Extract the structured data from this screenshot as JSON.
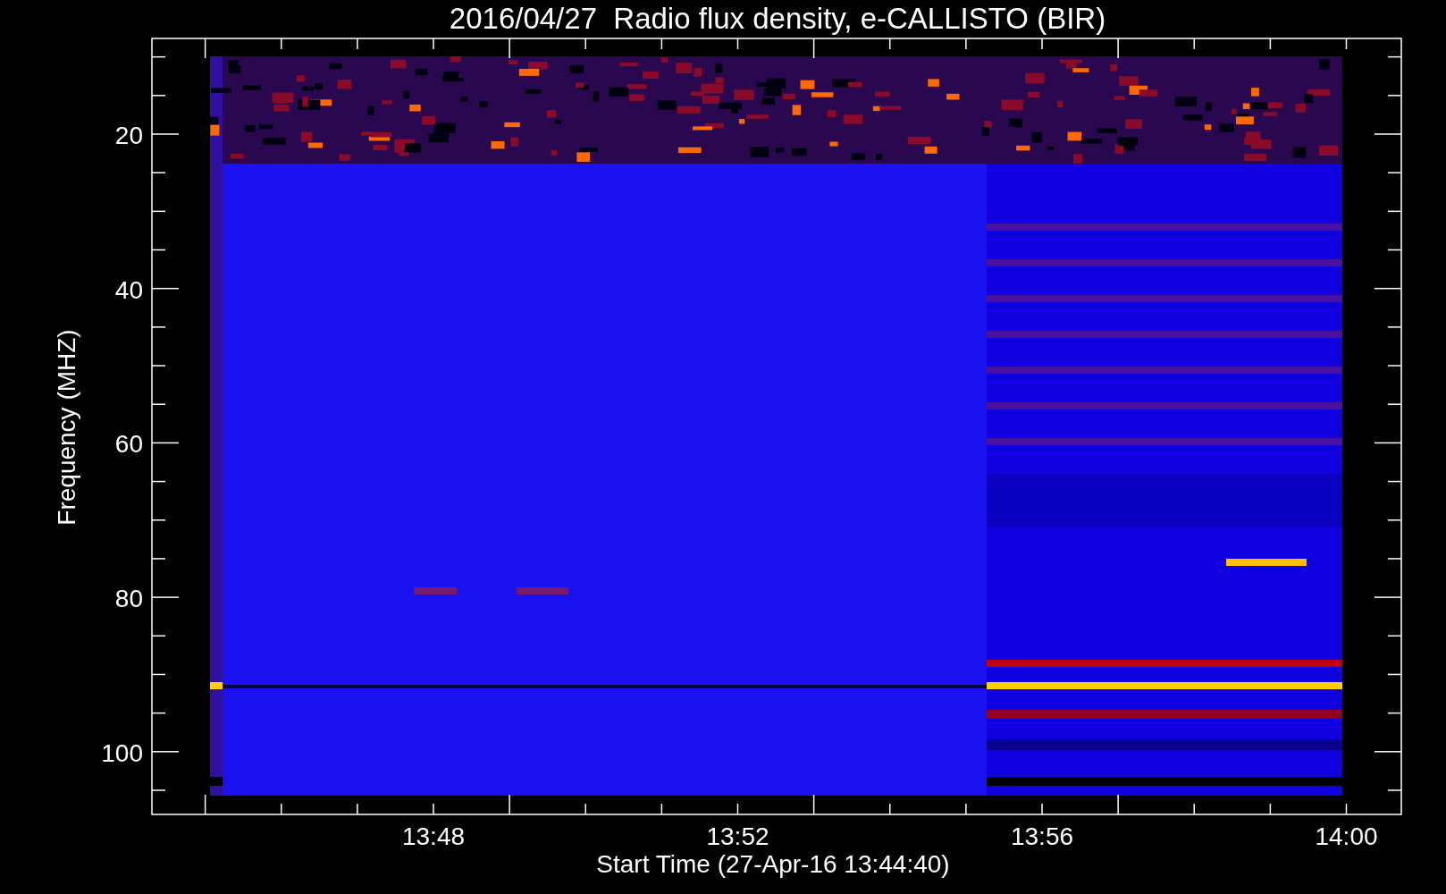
{
  "title": "2016/04/27  Radio flux density, e-CALLISTO (BIR)",
  "y_axis": {
    "label": "Frequency (MHZ)",
    "ticks": [
      "20",
      "40",
      "60",
      "80",
      "100"
    ]
  },
  "x_axis": {
    "label": "Start Time (27-Apr-16 13:44:40)",
    "ticks": [
      "13:48",
      "13:52",
      "13:56",
      "14:00"
    ]
  }
}
